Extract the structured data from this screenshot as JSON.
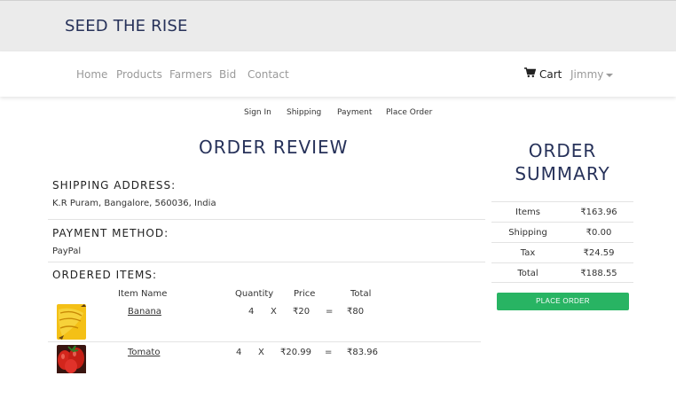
{
  "header": {
    "brand": "SEED THE RISE"
  },
  "nav": {
    "links": [
      "Home",
      "Products",
      "Farmers",
      "Bid",
      "Contact"
    ],
    "cart_label": "Cart",
    "user_label": "Jimmy"
  },
  "steps": [
    "Sign In",
    "Shipping",
    "Payment",
    "Place Order"
  ],
  "review": {
    "title": "ORDER REVIEW",
    "shipping_heading": "SHIPPING ADDRESS:",
    "shipping_address": "K.R Puram, Bangalore, 560036, India",
    "payment_heading": "PAYMENT METHOD:",
    "payment_method": "PayPal",
    "items_heading": "ORDERED ITEMS:",
    "columns": [
      "Item Name",
      "Quantity",
      "Price",
      "Total"
    ],
    "items": [
      {
        "name": "Banana",
        "qty": "4",
        "x": "X",
        "price": "₹20",
        "eq": "=",
        "total": "₹80",
        "image": "banana-image"
      },
      {
        "name": "Tomato",
        "qty": "4",
        "x": "X",
        "price": "₹20.99",
        "eq": "=",
        "total": "₹83.96",
        "image": "tomato-image"
      }
    ]
  },
  "summary": {
    "title_line1": "ORDER",
    "title_line2": "SUMMARY",
    "rows": [
      {
        "label": "Items",
        "value": "₹163.96"
      },
      {
        "label": "Shipping",
        "value": "₹0.00"
      },
      {
        "label": "Tax",
        "value": "₹24.59"
      },
      {
        "label": "Total",
        "value": "₹188.55"
      }
    ],
    "button_label": "PLACE ORDER"
  },
  "colors": {
    "brand": "#27325a",
    "button": "#28b463"
  },
  "icons": {
    "cart": "shopping-cart-icon",
    "user_menu": "caret-down-icon"
  }
}
